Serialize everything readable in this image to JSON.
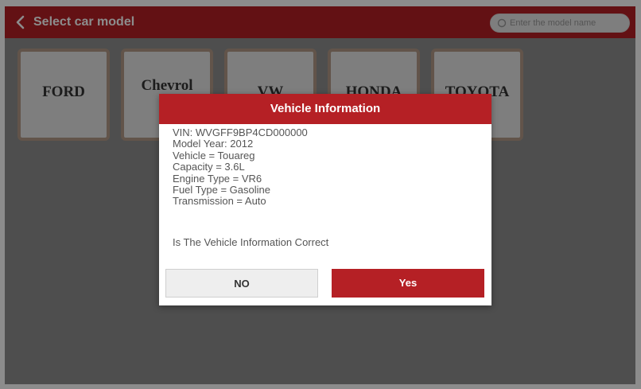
{
  "header": {
    "title": "Select car model",
    "search_placeholder": "Enter the model name"
  },
  "brands": [
    "FORD",
    "Chevrol",
    "VW",
    "HONDA",
    "TOYOTA"
  ],
  "dialog": {
    "title": "Vehicle Information",
    "lines": [
      "VIN: WVGFF9BP4CD000000",
      "Model Year: 2012",
      "Vehicle = Touareg",
      "Capacity = 3.6L",
      "Engine Type = VR6",
      "Fuel Type = Gasoline",
      "Transmission = Auto"
    ],
    "question": "Is The Vehicle Information Correct",
    "no_label": "NO",
    "yes_label": "Yes"
  },
  "colors": {
    "accent": "#b52025",
    "background": "#8e8e8e",
    "tile": "#e6e6e6",
    "tile_border": "#b29a88"
  },
  "icons": {
    "back": "chevron-left-icon",
    "search": "search-icon"
  }
}
